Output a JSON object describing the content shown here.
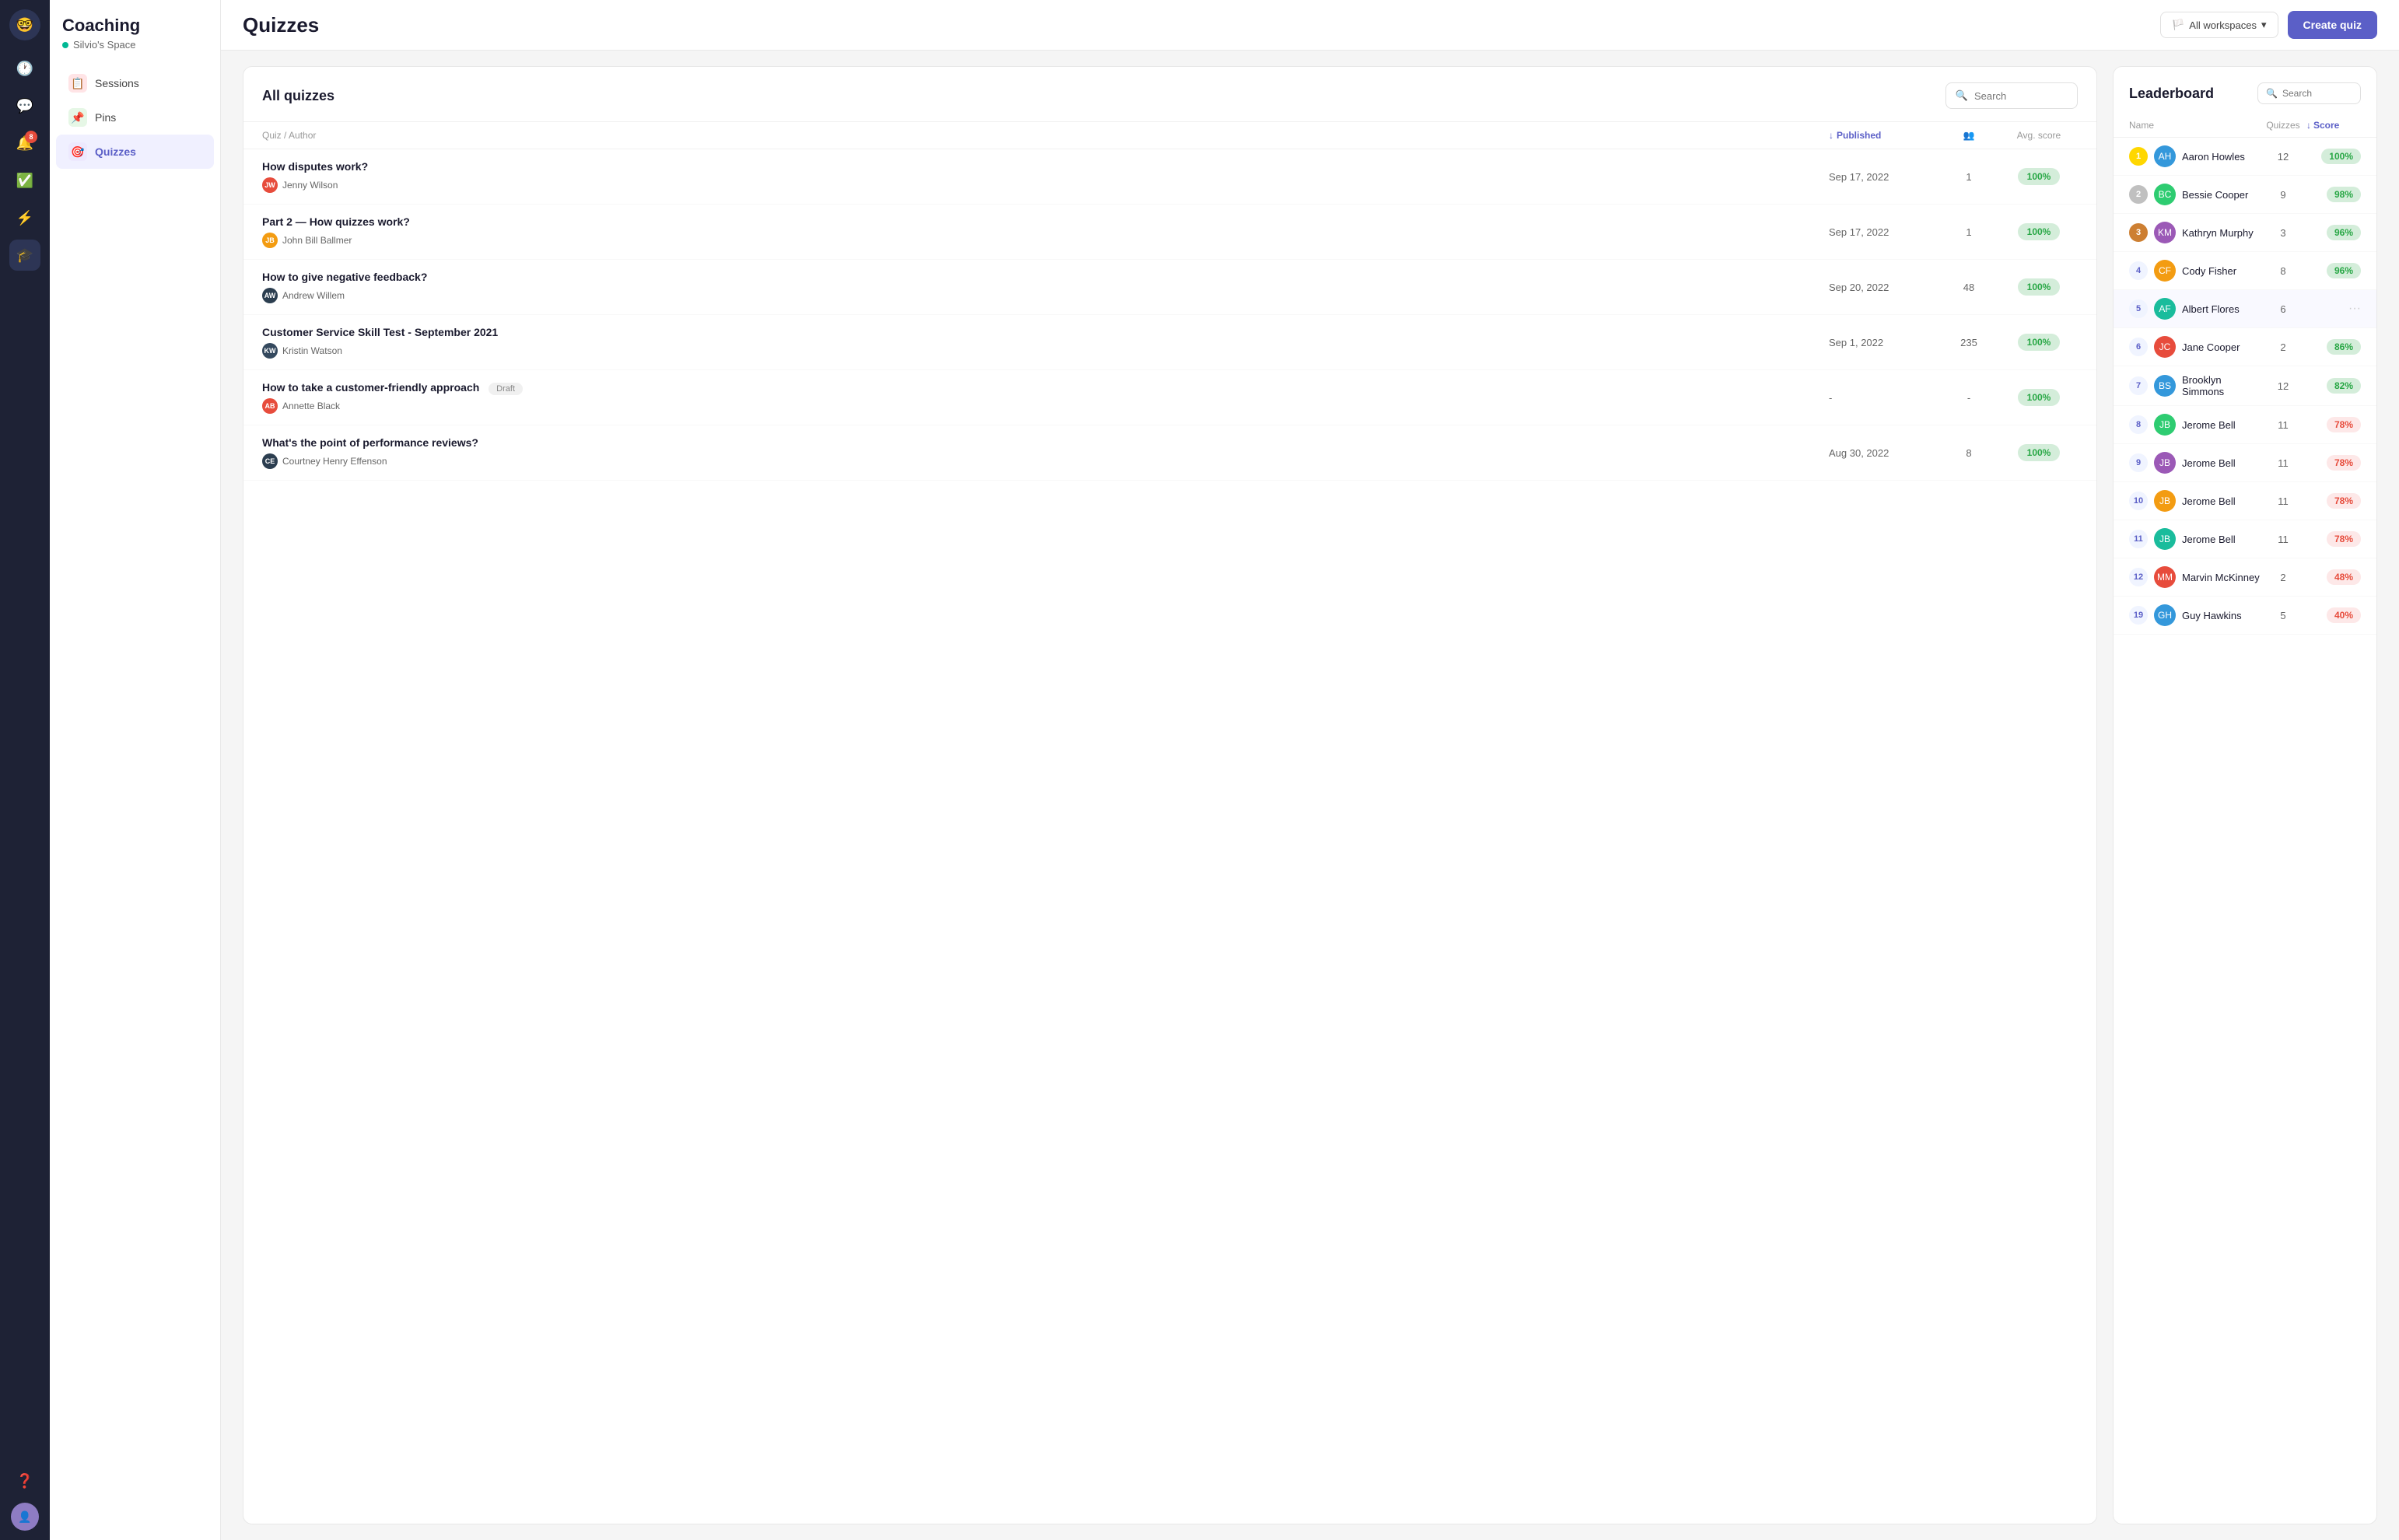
{
  "app": {
    "logo": "🤓",
    "title": "Coaching",
    "workspace": "Silvio's Space"
  },
  "sidebar_dark": {
    "icons": [
      {
        "name": "clock-icon",
        "symbol": "🕐",
        "active": false
      },
      {
        "name": "chat-icon",
        "symbol": "💬",
        "active": false
      },
      {
        "name": "notifications-icon",
        "symbol": "🔔",
        "active": false,
        "badge": "8"
      },
      {
        "name": "tasks-icon",
        "symbol": "✅",
        "active": false
      },
      {
        "name": "lightning-icon",
        "symbol": "⚡",
        "active": false
      },
      {
        "name": "graduation-icon",
        "symbol": "🎓",
        "active": true
      }
    ],
    "help_icon": "❓",
    "user_avatar": "👤"
  },
  "left_nav": {
    "items": [
      {
        "id": "sessions",
        "label": "Sessions",
        "icon": "📋",
        "active": false
      },
      {
        "id": "pins",
        "label": "Pins",
        "icon": "📌",
        "active": false
      },
      {
        "id": "quizzes",
        "label": "Quizzes",
        "icon": "🎯",
        "active": true
      }
    ]
  },
  "topbar": {
    "title": "Quizzes",
    "workspace_selector": "All workspaces",
    "create_button": "Create quiz"
  },
  "quizzes_panel": {
    "title": "All quizzes",
    "search_placeholder": "Search",
    "columns": {
      "quiz_author": "Quiz / Author",
      "published": "Published",
      "count": "",
      "avg_score": "Avg. score"
    },
    "rows": [
      {
        "name": "How disputes work?",
        "author": "Jenny Wilson",
        "author_color": "#e74c3c",
        "author_initials": "JW",
        "date": "Sep 17, 2022",
        "count": "1",
        "score": "100%",
        "draft": false
      },
      {
        "name": "Part 2 — How quizzes work?",
        "author": "John Bill Ballmer",
        "author_color": "#f39c12",
        "author_initials": "JB",
        "date": "Sep 17, 2022",
        "count": "1",
        "score": "100%",
        "draft": false
      },
      {
        "name": "How to give negative feedback?",
        "author": "Andrew Willem",
        "author_color": "#2c3e50",
        "author_initials": "AW",
        "date": "Sep 20, 2022",
        "count": "48",
        "score": "100%",
        "draft": false
      },
      {
        "name": "Customer Service Skill Test - September 2021",
        "author": "Kristin Watson",
        "author_color": "#34495e",
        "author_initials": "KW",
        "date": "Sep 1, 2022",
        "count": "235",
        "score": "100%",
        "draft": false
      },
      {
        "name": "How to take a customer-friendly approach",
        "author": "Annette Black",
        "author_color": "#e74c3c",
        "author_initials": "AB",
        "date": "-",
        "count": "-",
        "score": "100%",
        "draft": true
      },
      {
        "name": "What's the point of performance reviews?",
        "author": "Courtney Henry Effenson",
        "author_color": "#2c3e50",
        "author_initials": "CE",
        "date": "Aug 30, 2022",
        "count": "8",
        "score": "100%",
        "draft": false
      }
    ]
  },
  "leaderboard": {
    "title": "Leaderboard",
    "search_placeholder": "Search",
    "columns": {
      "name": "Name",
      "quizzes": "Quizzes",
      "score": "Score"
    },
    "rows": [
      {
        "rank": 1,
        "name": "Aaron Howles",
        "quizzes": 12,
        "score": "100%",
        "score_type": "green"
      },
      {
        "rank": 2,
        "name": "Bessie Cooper",
        "quizzes": 9,
        "score": "98%",
        "score_type": "green"
      },
      {
        "rank": 3,
        "name": "Kathryn Murphy",
        "quizzes": 3,
        "score": "96%",
        "score_type": "green"
      },
      {
        "rank": 4,
        "name": "Cody Fisher",
        "quizzes": 8,
        "score": "96%",
        "score_type": "green"
      },
      {
        "rank": 5,
        "name": "Albert Flores",
        "quizzes": 6,
        "score": "",
        "score_type": "dots",
        "highlighted": true
      },
      {
        "rank": 6,
        "name": "Jane Cooper",
        "quizzes": 2,
        "score": "86%",
        "score_type": "green"
      },
      {
        "rank": 7,
        "name": "Brooklyn Simmons",
        "quizzes": 12,
        "score": "82%",
        "score_type": "green"
      },
      {
        "rank": 8,
        "name": "Jerome Bell",
        "quizzes": 11,
        "score": "78%",
        "score_type": "red"
      },
      {
        "rank": 9,
        "name": "Jerome Bell",
        "quizzes": 11,
        "score": "78%",
        "score_type": "red"
      },
      {
        "rank": 10,
        "name": "Jerome Bell",
        "quizzes": 11,
        "score": "78%",
        "score_type": "red"
      },
      {
        "rank": 11,
        "name": "Jerome Bell",
        "quizzes": 11,
        "score": "78%",
        "score_type": "red"
      },
      {
        "rank": 12,
        "name": "Marvin McKinney",
        "quizzes": 2,
        "score": "48%",
        "score_type": "pink"
      },
      {
        "rank": 19,
        "name": "Guy Hawkins",
        "quizzes": 5,
        "score": "40%",
        "score_type": "pink"
      }
    ]
  }
}
